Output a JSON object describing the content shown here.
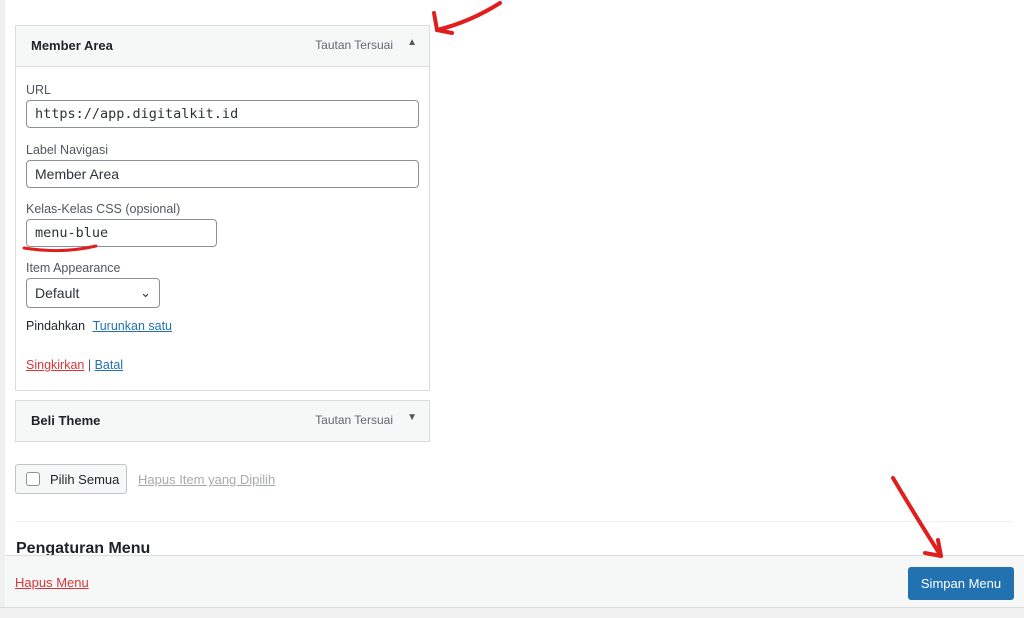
{
  "menu_items": [
    {
      "title": "Member Area",
      "type": "Tautan Tersuai",
      "expanded": true,
      "fields": {
        "url_label": "URL",
        "url_value": "https://app.digitalkit.id",
        "nav_label_label": "Label Navigasi",
        "nav_label_value": "Member Area",
        "css_label": "Kelas-Kelas CSS (opsional)",
        "css_value": "menu-blue",
        "appearance_label": "Item Appearance",
        "appearance_value": "Default",
        "move_label": "Pindahkan",
        "move_down": "Turunkan satu",
        "remove": "Singkirkan",
        "separator": "|",
        "cancel": "Batal"
      }
    },
    {
      "title": "Beli Theme",
      "type": "Tautan Tersuai",
      "expanded": false
    }
  ],
  "bulk": {
    "select_all": "Pilih Semua",
    "remove_selected": "Hapus Item yang Dipilih"
  },
  "section": {
    "heading": "Pengaturan Menu"
  },
  "footer": {
    "delete_menu": "Hapus Menu",
    "save_menu": "Simpan Menu"
  },
  "icons": {
    "collapse": "arrow-up-icon",
    "expand": "arrow-down-icon",
    "select_chevron": "chevron-down-icon"
  },
  "colors": {
    "accent": "#2271b1",
    "danger": "#d63638",
    "annotation": "#e01e1e"
  }
}
